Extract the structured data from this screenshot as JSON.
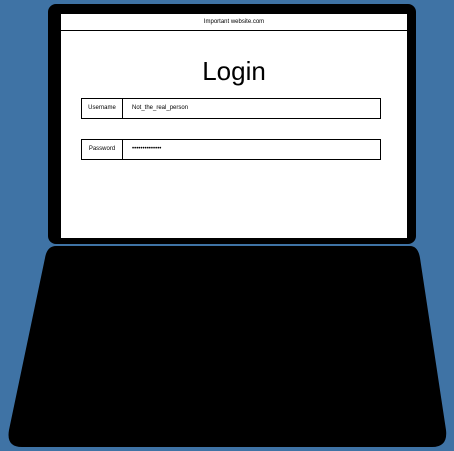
{
  "browser": {
    "address": "Important website.com"
  },
  "login": {
    "title": "Login",
    "username_label": "Username",
    "username_value": "Not_the_real_person",
    "password_label": "Password",
    "password_value": "••••••••••••••"
  },
  "colors": {
    "background": "#3f73a5",
    "laptop": "#000000",
    "screen": "#ffffff"
  }
}
